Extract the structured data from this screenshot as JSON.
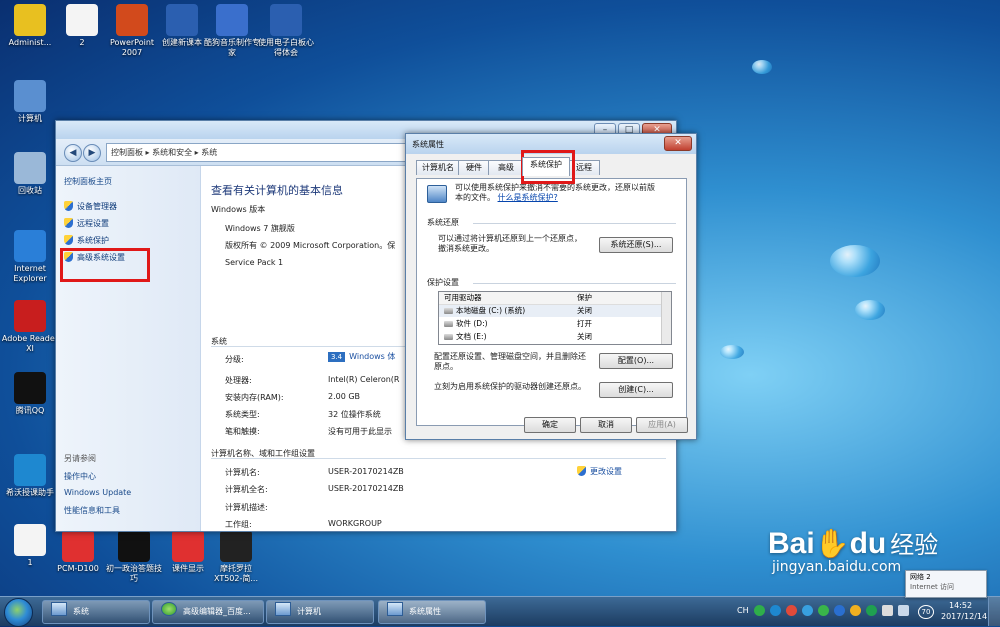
{
  "desktop": {
    "icons": [
      {
        "label": "Administ...",
        "color": "#e8c020",
        "glyph": "folder-icon"
      },
      {
        "label": "2",
        "color": "#f4f4f4",
        "glyph": "doc-icon"
      },
      {
        "label": "PowerPoint 2007",
        "color": "#d24a1c",
        "glyph": "powerpoint-icon"
      },
      {
        "label": "创建新课本",
        "color": "#2b5fb0",
        "glyph": "word-icon"
      },
      {
        "label": "酷狗音乐制作专家",
        "color": "#3a6fcc",
        "glyph": "audio-icon"
      },
      {
        "label": "使用电子白板心得体会",
        "color": "#2b5fb0",
        "glyph": "word-icon"
      },
      {
        "label": "计算机",
        "color": "#5a8fd0",
        "glyph": "computer-icon"
      },
      {
        "label": "回收站",
        "color": "#9ab8d8",
        "glyph": "recycle-bin-icon"
      },
      {
        "label": "Internet Explorer",
        "color": "#2a7fd8",
        "glyph": "ie-icon"
      },
      {
        "label": "Adobe Reader XI",
        "color": "#c81e1e",
        "glyph": "pdf-icon"
      },
      {
        "label": "腾讯QQ",
        "color": "#111111",
        "glyph": "qq-icon"
      },
      {
        "label": "希沃授课助手",
        "color": "#1e88d0",
        "glyph": "link-icon"
      },
      {
        "label": "1",
        "color": "#f4f4f4",
        "glyph": "calendar-icon"
      },
      {
        "label": "PCM-D100",
        "color": "#e03030",
        "glyph": "pdf-icon"
      },
      {
        "label": "初一政治答题技巧",
        "color": "#111111",
        "glyph": "doc-icon"
      },
      {
        "label": "课件显示",
        "color": "#e03030",
        "glyph": "pdf-icon"
      },
      {
        "label": "摩托罗拉XT502-简...",
        "color": "#222222",
        "glyph": "doc-icon"
      }
    ]
  },
  "control_panel": {
    "breadcrumb": [
      "控制面板",
      "系统和安全",
      "系统"
    ],
    "sidebar": {
      "home": "控制面板主页",
      "items": [
        "设备管理器",
        "远程设置",
        "系统保护",
        "高级系统设置"
      ],
      "see_also_title": "另请参阅",
      "see_also": [
        "操作中心",
        "Windows Update",
        "性能信息和工具"
      ]
    },
    "title": "查看有关计算机的基本信息",
    "edition": {
      "heading": "Windows 版本",
      "name": "Windows 7 旗舰版",
      "copyright": "版权所有 © 2009 Microsoft Corporation。保",
      "service_pack": "Service Pack 1"
    },
    "system": {
      "heading": "系统",
      "rows": [
        {
          "label": "分级:",
          "value": "Windows 体"
        },
        {
          "label": "处理器:",
          "value": "Intel(R) Celeron(R"
        },
        {
          "label": "安装内存(RAM):",
          "value": "2.00 GB"
        },
        {
          "label": "系统类型:",
          "value": "32 位操作系统"
        },
        {
          "label": "笔和触摸:",
          "value": "没有可用于此显示"
        }
      ],
      "rating_badge": "3.4"
    },
    "network": {
      "heading": "计算机名称、域和工作组设置",
      "rows": [
        {
          "label": "计算机名:",
          "value": "USER-20170214ZB"
        },
        {
          "label": "计算机全名:",
          "value": "USER-20170214ZB"
        },
        {
          "label": "计算机描述:",
          "value": ""
        },
        {
          "label": "工作组:",
          "value": "WORKGROUP"
        }
      ],
      "change_settings": "更改设置"
    }
  },
  "system_properties": {
    "title": "系统属性",
    "tabs": [
      "计算机名",
      "硬件",
      "高级",
      "系统保护",
      "远程"
    ],
    "active_tab": "系统保护",
    "intro": [
      "可以使用系统保护来撤消不需要的系统更改，还原以前版",
      "本的文件。"
    ],
    "intro_link": "什么是系统保护?",
    "restore_group": "系统还原",
    "restore_text": [
      "可以通过将计算机还原到上一个还原点，",
      "撤消系统更改。"
    ],
    "restore_button": "系统还原(S)...",
    "protection_group": "保护设置",
    "list_headers": [
      "可用驱动器",
      "保护"
    ],
    "drives": [
      {
        "name": "本地磁盘 (C:) (系统)",
        "status": "关闭"
      },
      {
        "name": "软件 (D:)",
        "status": "打开"
      },
      {
        "name": "文档 (E:)",
        "status": "关闭"
      }
    ],
    "configure_text": [
      "配置还原设置、管理磁盘空间，并且删除还",
      "原点。"
    ],
    "configure_button": "配置(O)...",
    "create_text": "立刻为启用系统保护的驱动器创建还原点。",
    "create_button": "创建(C)...",
    "ok": "确定",
    "cancel": "取消",
    "apply": "应用(A)"
  },
  "taskbar": {
    "buttons": [
      "系统",
      "高级编辑器_百度...",
      "计算机",
      "系统属性"
    ],
    "tray": {
      "lang": "CH",
      "network_label": "网络 2",
      "network_sub": "Internet 访问",
      "battery": "70"
    },
    "time": "14:52",
    "date": "2017/12/14"
  },
  "watermark": {
    "brand": "Bai",
    "paw": "du",
    "cn": "经验",
    "url": "jingyan.baidu.com"
  }
}
